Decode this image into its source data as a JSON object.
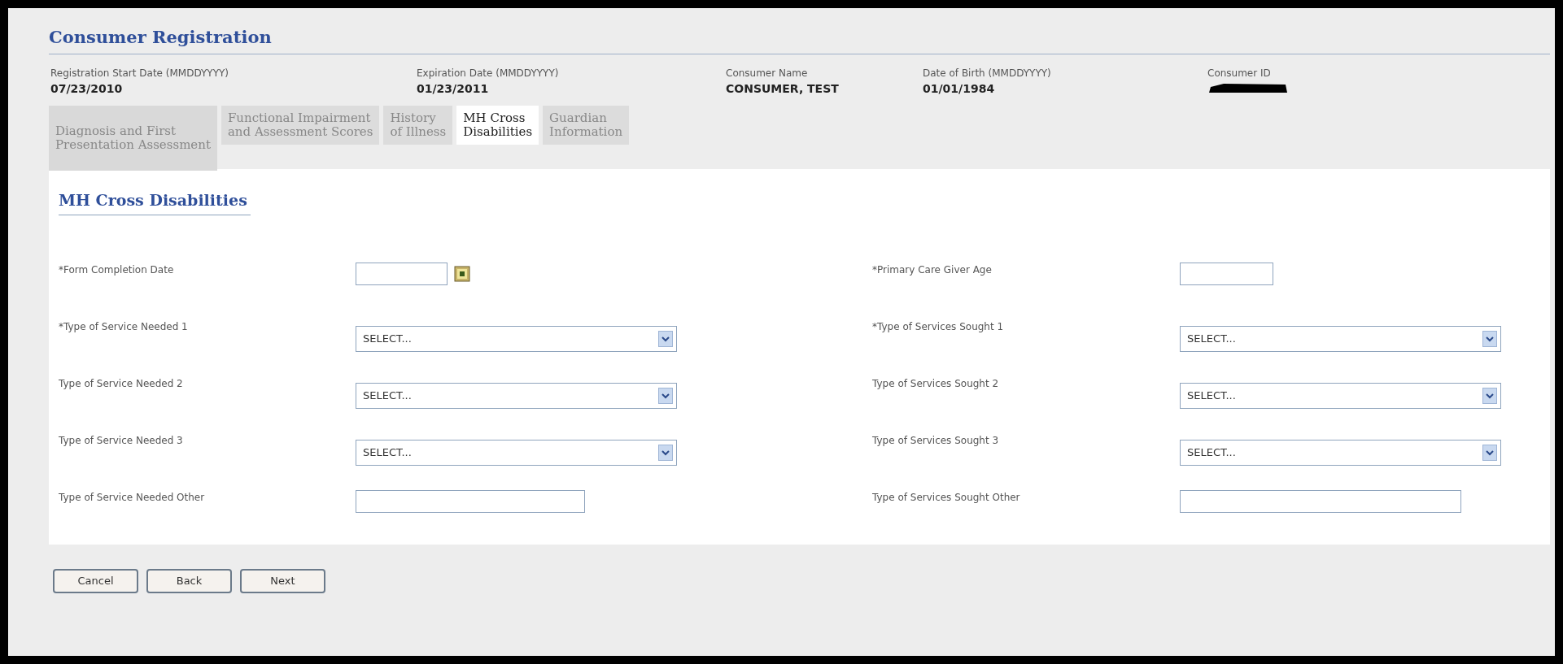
{
  "page": {
    "title": "Consumer Registration"
  },
  "info": [
    {
      "label": "Registration Start Date (MMDDYYYY)",
      "value": "07/23/2010",
      "kind": "text"
    },
    {
      "label": "Expiration Date (MMDDYYYY)",
      "value": "01/23/2011",
      "kind": "text"
    },
    {
      "label": "Consumer Name",
      "value": "CONSUMER, TEST",
      "kind": "text"
    },
    {
      "label": "Date of Birth (MMDDYYYY)",
      "value": "01/01/1984",
      "kind": "text"
    },
    {
      "label": "Consumer ID",
      "kind": "redacted"
    }
  ],
  "tabs": [
    {
      "label": "Diagnosis and First\nPresentation Assessment",
      "selected": false
    },
    {
      "label": "Functional Impairment\nand Assessment Scores",
      "selected": false
    },
    {
      "label": "History\nof Illness",
      "selected": false
    },
    {
      "label": "MH Cross\nDisabilities",
      "selected": true
    },
    {
      "label": "Guardian\nInformation",
      "selected": false
    }
  ],
  "section": {
    "title": "MH Cross Disabilities"
  },
  "left_fields": [
    {
      "label": "*Form Completion Date",
      "kind": "date"
    },
    {
      "label": "*Type of Service Needed 1",
      "kind": "select",
      "value": "SELECT..."
    },
    {
      "label": "Type of Service Needed 2",
      "kind": "select",
      "value": "SELECT..."
    },
    {
      "label": "Type of Service Needed 3",
      "kind": "select",
      "value": "SELECT..."
    },
    {
      "label": "Type of Service Needed Other",
      "kind": "text"
    }
  ],
  "right_fields": [
    {
      "label": "*Primary Care Giver Age",
      "kind": "short"
    },
    {
      "label": "*Type of Services Sought 1",
      "kind": "select",
      "value": "SELECT..."
    },
    {
      "label": "Type of Services Sought 2",
      "kind": "select",
      "value": "SELECT..."
    },
    {
      "label": "Type of Services Sought 3",
      "kind": "select",
      "value": "SELECT..."
    },
    {
      "label": "Type of Services Sought Other",
      "kind": "text"
    }
  ],
  "buttons": [
    "Cancel",
    "Back",
    "Next"
  ]
}
